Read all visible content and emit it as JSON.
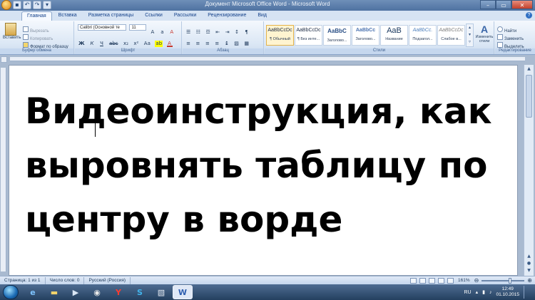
{
  "window": {
    "title": "Документ Microsoft Office Word  -  Microsoft Word",
    "controls": [
      "–",
      "▭",
      "✕"
    ]
  },
  "tabs": [
    "Главная",
    "Вставка",
    "Разметка страницы",
    "Ссылки",
    "Рассылки",
    "Рецензирование",
    "Вид"
  ],
  "ribbon": {
    "clipboard": {
      "paste": "Вставить",
      "cut": "Вырезать",
      "copy": "Копировать",
      "format_painter": "Формат по образцу",
      "group": "Буфер обмена"
    },
    "font": {
      "name": "Calibri (Основной те",
      "size": "11",
      "group": "Шрифт"
    },
    "paragraph": {
      "group": "Абзац"
    },
    "styles": {
      "items": [
        {
          "sample": "AaBbCcDc",
          "name": "¶ Обычный"
        },
        {
          "sample": "AaBbCcDc",
          "name": "¶ Без инте..."
        },
        {
          "sample": "AaBbC",
          "name": "Заголово..."
        },
        {
          "sample": "AaBbCc",
          "name": "Заголово..."
        },
        {
          "sample": "AaB",
          "name": "Название"
        },
        {
          "sample": "AaBbCc.",
          "name": "Подзагол..."
        },
        {
          "sample": "AaBbCcDc",
          "name": "Слабое в..."
        }
      ],
      "change_styles": "Изменить стили",
      "group": "Стили"
    },
    "editing": {
      "find": "Найти",
      "replace": "Заменить",
      "select": "Выделить",
      "group": "Редактирование"
    }
  },
  "document": {
    "line1": "Видеоинструкция, как",
    "line2": "выровнять таблицу по",
    "line3": "центру в ворде"
  },
  "statusbar": {
    "page": "Страница: 1 из 1",
    "words": "Число слов: 0",
    "language": "Русский (Россия)",
    "zoom": "161%"
  },
  "taskbar": {
    "lang": "RU",
    "time": "12:49",
    "date": "01.10.2015"
  }
}
